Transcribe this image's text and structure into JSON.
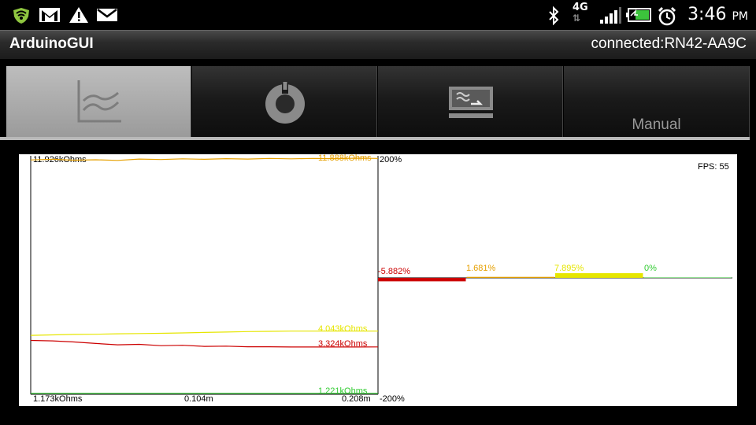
{
  "status_bar": {
    "time": "3:46",
    "ampm": "PM",
    "network_label": "4G",
    "icons": [
      "shield-icon",
      "gmail-icon",
      "warning-icon",
      "mail-icon",
      "bluetooth-icon",
      "network-4g-icon",
      "signal-icon",
      "battery-icon",
      "alarm-icon"
    ]
  },
  "titlebar": {
    "app_name": "ArduinoGUI",
    "connection": "connected:RN42-AA9C"
  },
  "tabs": [
    {
      "name": "graph",
      "icon": "line-chart-icon",
      "label": "",
      "active": true
    },
    {
      "name": "settings",
      "icon": "gear-knob-icon",
      "label": "",
      "active": false
    },
    {
      "name": "terminal",
      "icon": "terminal-icon",
      "label": "",
      "active": false
    },
    {
      "name": "manual",
      "icon": "",
      "label": "Manual",
      "active": false
    }
  ],
  "fps": "FPS: 55",
  "chart_data": [
    {
      "type": "line",
      "y_max_label": "11.926kOhms",
      "y_min_label": "1.173kOhms",
      "x_tick_labels": [
        "0.104m",
        "0.208m"
      ],
      "ylim": [
        1.173,
        11.926
      ],
      "xlim": [
        0,
        0.208
      ],
      "series": [
        {
          "value_label": "11.888kOhms",
          "color": "#e6a000",
          "values": [
            11.81,
            11.84,
            11.8,
            11.82,
            11.79,
            11.85,
            11.83,
            11.86,
            11.84,
            11.87,
            11.85,
            11.88,
            11.86,
            11.88,
            11.87,
            11.89,
            11.88
          ]
        },
        {
          "value_label": "4.043kOhms",
          "color": "#e6e600",
          "values": [
            3.85,
            3.87,
            3.89,
            3.9,
            3.92,
            3.93,
            3.94,
            3.96,
            3.98,
            4.0,
            4.02,
            4.03,
            4.04,
            4.04,
            4.04,
            4.04,
            4.043
          ]
        },
        {
          "value_label": "3.324kOhms",
          "color": "#cc0000",
          "values": [
            3.62,
            3.6,
            3.55,
            3.48,
            3.42,
            3.44,
            3.38,
            3.4,
            3.35,
            3.36,
            3.33,
            3.33,
            3.32,
            3.32,
            3.32,
            3.32,
            3.324
          ]
        },
        {
          "value_label": "1.221kOhms",
          "color": "#33cc33",
          "values": [
            1.22,
            1.22,
            1.22,
            1.22,
            1.22,
            1.22,
            1.22,
            1.22,
            1.22,
            1.22,
            1.22,
            1.22,
            1.22,
            1.22,
            1.22,
            1.22,
            1.221
          ]
        }
      ]
    },
    {
      "type": "bar",
      "y_max_label": "200%",
      "y_min_label": "-200%",
      "ylim": [
        -200,
        200
      ],
      "series": [
        {
          "value_label": "-5.882%",
          "value": -5.882,
          "color": "#cc0000"
        },
        {
          "value_label": "1.681%",
          "value": 1.681,
          "color": "#e6a000"
        },
        {
          "value_label": "7.895%",
          "value": 7.895,
          "color": "#e6e600"
        },
        {
          "value_label": "0%",
          "value": 0,
          "color": "#33cc33"
        }
      ]
    }
  ]
}
